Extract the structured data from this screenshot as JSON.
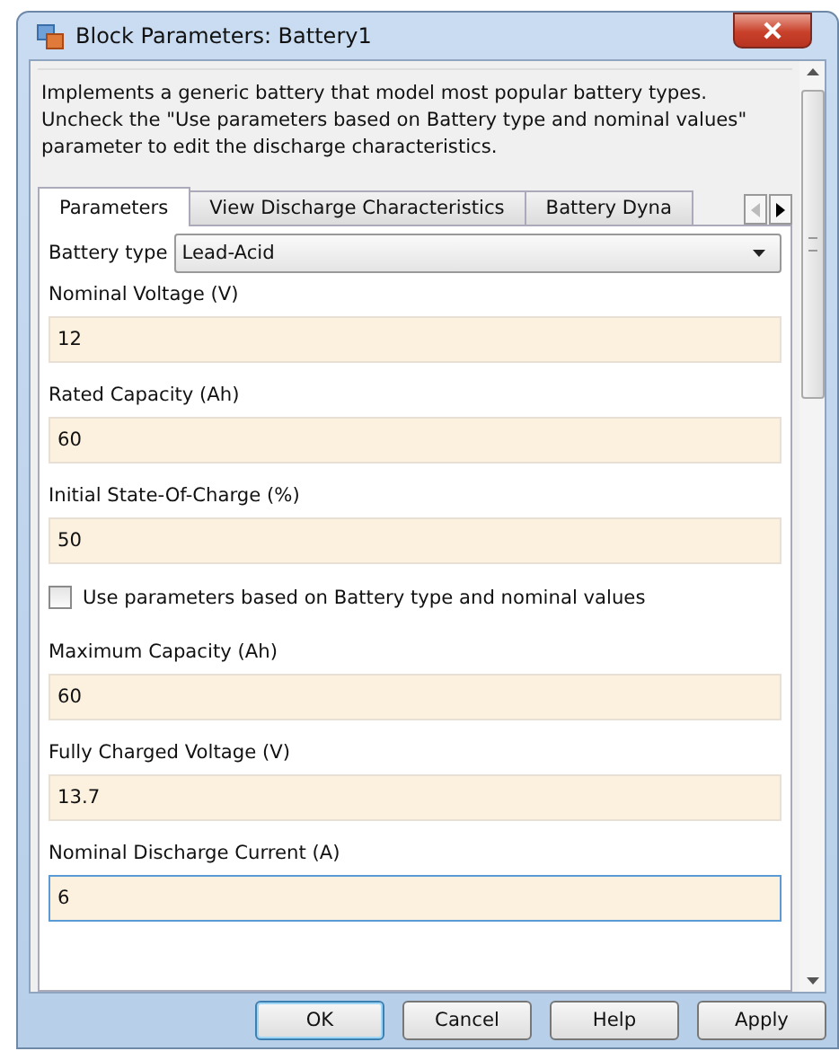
{
  "window": {
    "title": "Block Parameters: Battery1"
  },
  "description": "Implements a generic battery that model most popular battery types. Uncheck the \"Use parameters based on Battery type and nominal values\" parameter to edit the discharge characteristics.",
  "tabs": [
    {
      "label": "Parameters",
      "selected": true
    },
    {
      "label": "View Discharge Characteristics",
      "selected": false
    },
    {
      "label": "Battery Dyna",
      "selected": false
    }
  ],
  "battery_type": {
    "label": "Battery type",
    "value": "Lead-Acid"
  },
  "parameters": [
    {
      "kind": "field",
      "label": "Nominal Voltage (V)",
      "value": "12",
      "focused": false
    },
    {
      "kind": "field",
      "label": "Rated Capacity (Ah)",
      "value": "60",
      "focused": false
    },
    {
      "kind": "field",
      "label": "Initial State-Of-Charge (%)",
      "value": "50",
      "focused": false
    },
    {
      "kind": "checkbox",
      "label": "Use parameters based on Battery type and nominal values",
      "checked": false
    },
    {
      "kind": "field",
      "label": "Maximum Capacity (Ah)",
      "value": "60",
      "focused": false
    },
    {
      "kind": "field",
      "label": "Fully Charged Voltage (V)",
      "value": "13.7",
      "focused": false
    },
    {
      "kind": "field",
      "label": "Nominal Discharge Current (A)",
      "value": "6",
      "focused": true
    }
  ],
  "buttons": [
    {
      "label": "OK",
      "default": true
    },
    {
      "label": "Cancel",
      "default": false
    },
    {
      "label": "Help",
      "default": false
    },
    {
      "label": "Apply",
      "default": false
    }
  ]
}
